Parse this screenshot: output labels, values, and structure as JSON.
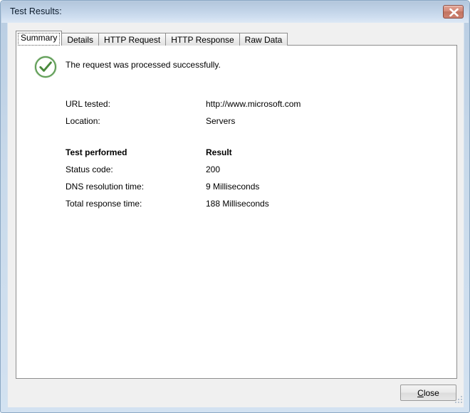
{
  "window": {
    "title": "Test Results:",
    "close_button_icon": "close-x-icon",
    "frame_color": "#b9cde2",
    "titlebar_color": "#c2d4e8",
    "close_button_color": "#d48b7b"
  },
  "tabs": [
    {
      "label": "Summary",
      "selected": true
    },
    {
      "label": "Details",
      "selected": false
    },
    {
      "label": "HTTP Request",
      "selected": false
    },
    {
      "label": "HTTP Response",
      "selected": false
    },
    {
      "label": "Raw Data",
      "selected": false
    }
  ],
  "summary": {
    "status_icon": "success-check-circle-icon",
    "status_icon_color": "#4a8a3c",
    "status_message": "The request was processed successfully.",
    "info_rows": [
      {
        "label": "URL tested:",
        "value": "http://www.microsoft.com"
      },
      {
        "label": "Location:",
        "value": "Servers"
      }
    ],
    "results_header": {
      "label": "Test performed",
      "value": "Result"
    },
    "result_rows": [
      {
        "label": "Status code:",
        "value": "200"
      },
      {
        "label": "DNS resolution time:",
        "value": "9 Milliseconds"
      },
      {
        "label": "Total response time:",
        "value": "188 Milliseconds"
      }
    ]
  },
  "footer": {
    "close_accel": "C",
    "close_rest": "lose"
  }
}
